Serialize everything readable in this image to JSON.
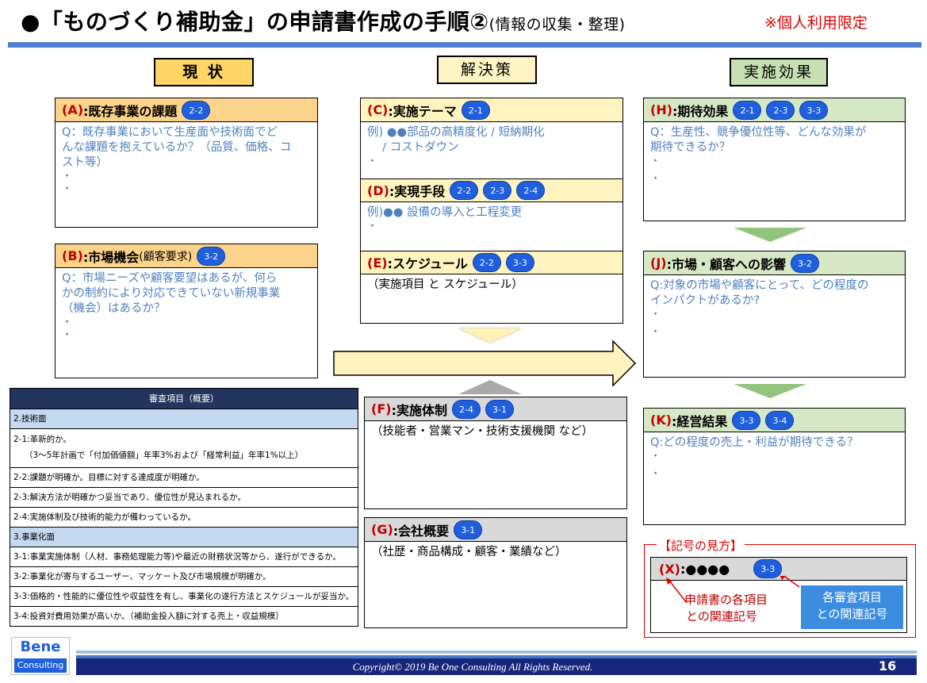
{
  "header": {
    "title_main": "●「ものづくり補助金」の申請書作成の手順②",
    "title_sub": "(情報の収集・整理)",
    "limited": "※個人利用限定"
  },
  "columns": {
    "current": "現 状",
    "solution": "解決策",
    "effect": "実施効果"
  },
  "boxes": {
    "A": {
      "letter": "(A)",
      "title": ":既存事業の課題",
      "badges": [
        "2-2"
      ],
      "lines": [
        "Q：既存事業において生産面や技術面でど",
        "んな課題を抱えているか？（品質、価格、コ",
        "スト等）"
      ],
      "bullets": [
        "・",
        "・"
      ]
    },
    "B": {
      "letter": "(B)",
      "title": ":市場機会",
      "paren": "(顧客要求)",
      "badges": [
        "3-2"
      ],
      "lines": [
        "Q：市場ニーズや顧客要望はあるが、何ら",
        "かの制約により対応できていない新規事業",
        "（機会）はあるか？"
      ],
      "bullets": [
        "・",
        "・"
      ]
    },
    "C": {
      "letter": "(C)",
      "title": ":実施テーマ",
      "badges": [
        "2-1"
      ],
      "lines": [
        "例) ●●部品の高精度化 / 短納期化",
        "　 / コストダウン"
      ],
      "bullets": [
        "・"
      ]
    },
    "D": {
      "letter": "(D)",
      "title": ":実現手段",
      "badges": [
        "2-2",
        "2-3",
        "2-4"
      ],
      "lines": [
        "例)●● 設備の導入と工程変更"
      ],
      "bullets": [
        "・"
      ]
    },
    "E": {
      "letter": "(E)",
      "title": ":スケジュール",
      "badges": [
        "2-2",
        "3-3"
      ],
      "lines": [
        "（実施項目 と スケジュール）"
      ]
    },
    "F": {
      "letter": "(F)",
      "title": ":実施体制",
      "badges": [
        "2-4",
        "3-1"
      ],
      "lines": [
        "（技能者・営業マン・技術支援機関 など）"
      ]
    },
    "G": {
      "letter": "(G)",
      "title": ":会社概要",
      "badges": [
        "3-1"
      ],
      "lines": [
        "（社歴・商品構成・顧客・業績など）"
      ]
    },
    "H": {
      "letter": "(H)",
      "title": ":期待効果",
      "badges": [
        "2-1",
        "2-3",
        "3-3"
      ],
      "lines": [
        "Q：生産性、競争優位性等、どんな効果が",
        "期待できるか？"
      ],
      "bullets": [
        "・",
        "・"
      ]
    },
    "J": {
      "letter": "(J)",
      "title": ":市場・顧客への影響",
      "badges": [
        "3-2"
      ],
      "lines": [
        "Q:対象の市場や顧客にとって、どの程度の",
        "インパクトがあるか?"
      ],
      "bullets": [
        "・",
        "・"
      ]
    },
    "K": {
      "letter": "(K)",
      "title": ":経営結果",
      "badges": [
        "3-3",
        "3-4"
      ],
      "lines": [
        "Q:どの程度の売上・利益が期待できる？"
      ],
      "bullets": [
        "・",
        "・"
      ]
    }
  },
  "review": {
    "header": "審査項目（概要）",
    "sec2": "2.技術面",
    "i21a": "2-1:革新的か。",
    "i21b": "（3～5年計画で「付加価値額」年率3%および「経常利益」年率1%以上）",
    "i22": "2-2:課題が明確か。目標に対する達成度が明確か。",
    "i23": "2-3:解決方法が明確かつ妥当であり、優位性が見込まれるか。",
    "i24": "2-4:実施体制及び技術的能力が備わっているか。",
    "sec3": "3.事業化面",
    "i31": "3-1:事業実施体制（人材、事務処理能力等)や最近の財務状況等から、遂行ができるか。",
    "i32": "3-2:事業化が寄与するユーザー、マッケート及び市場規模が明確か。",
    "i33": "3-3:価格的・性能的に優位性や収益性を有し、事業化の遂行方法とスケジュールが妥当か。",
    "i34": "3-4:投資対費用効果が高いか。（補助金投入額に対する売上・収益規模）"
  },
  "legend": {
    "title": "【記号の見方】",
    "letter": "(X)",
    "title_text": ":●●●●",
    "badge": "3-3",
    "note1_l1": "申請書の各項目",
    "note1_l2": "との関連記号",
    "note2_l1": "各審査項目",
    "note2_l2": "との関連記号"
  },
  "footer": {
    "copyright": "Copyright© 2019 Be One Consulting  All Rights Reserved.",
    "page": "16",
    "logo_top": "Bene",
    "logo_bottom": "Consulting"
  },
  "colors": {
    "accent_blue": "#4f7fd1",
    "badge_blue": "#1f5fdd",
    "red": "#e00000",
    "orange": "#fbd38a",
    "yellow": "#fff4bf",
    "green": "#d6e8c6",
    "gray": "#d9d9d9",
    "navy": "#17267a"
  }
}
